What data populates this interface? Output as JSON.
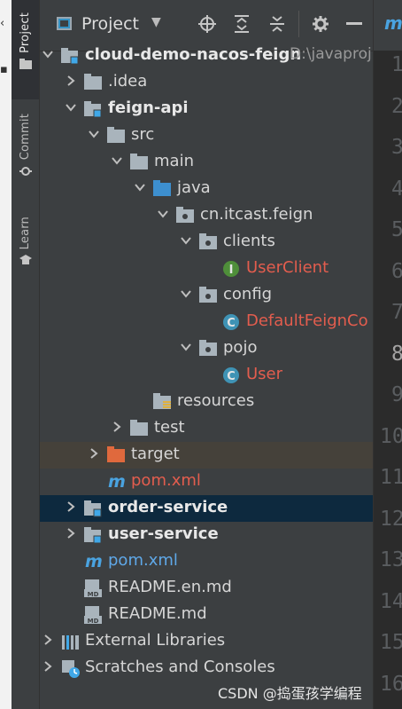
{
  "sidebar_tabs": [
    "Project",
    "Commit",
    "Learn"
  ],
  "project_panel": {
    "title": "Project",
    "toolbar": [
      "locate-icon",
      "expand-all-icon",
      "collapse-all-icon",
      "gear-icon",
      "minimize-icon"
    ]
  },
  "tree": [
    {
      "label": "cloud-demo-nacos-feign",
      "path": "D:\\javaproj"
    },
    {
      "label": ".idea"
    },
    {
      "label": "feign-api"
    },
    {
      "label": "src"
    },
    {
      "label": "main"
    },
    {
      "label": "java"
    },
    {
      "label": "cn.itcast.feign"
    },
    {
      "label": "clients"
    },
    {
      "label": "UserClient",
      "badge": "I"
    },
    {
      "label": "config"
    },
    {
      "label": "DefaultFeignCo",
      "badge": "C"
    },
    {
      "label": "pojo"
    },
    {
      "label": "User",
      "badge": "C"
    },
    {
      "label": "resources"
    },
    {
      "label": "test"
    },
    {
      "label": "target"
    },
    {
      "label": "pom.xml"
    },
    {
      "label": "order-service"
    },
    {
      "label": "user-service"
    },
    {
      "label": "pom.xml"
    },
    {
      "label": "README.en.md",
      "badge": "MD"
    },
    {
      "label": "README.md",
      "badge": "MD"
    },
    {
      "label": "External Libraries"
    },
    {
      "label": "Scratches and Consoles"
    }
  ],
  "editor": {
    "tab_glyph": "m",
    "line_numbers": [
      "1",
      "2",
      "3",
      "4",
      "5",
      "6",
      "7",
      "8",
      "9",
      "10",
      "11",
      "12",
      "13",
      "14",
      "15",
      "16"
    ]
  },
  "watermark": "CSDN @捣蛋孩学编程",
  "colors": {
    "panel_bg": "#3c3f41",
    "selection_blue": "#0d293e",
    "excluded_brown": "#45413a",
    "modified_red": "#e35d4e",
    "folder_blue": "#3d8fcf",
    "interface_green": "#4f8f3a",
    "class_teal": "#3f93b5"
  }
}
